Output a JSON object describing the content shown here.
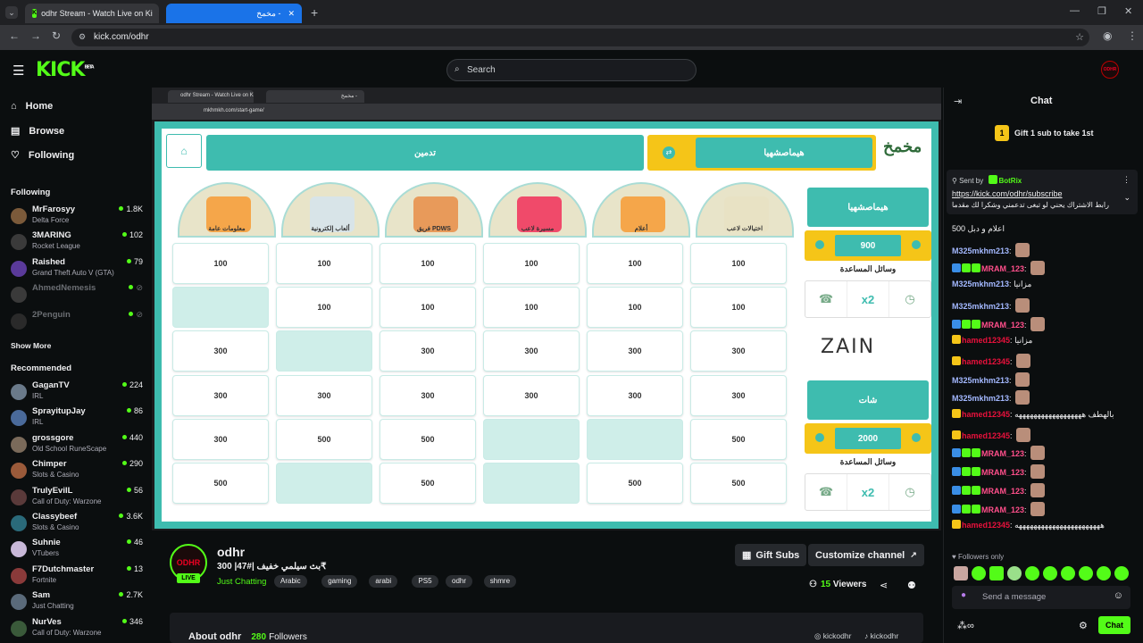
{
  "browser": {
    "tabs": [
      {
        "label": "odhr Stream - Watch Live on Ki"
      },
      {
        "label": "مخمخ -"
      }
    ],
    "url": "kick.com/odhr"
  },
  "header": {
    "logo": "KICK",
    "beta": "BETA",
    "search_placeholder": "Search",
    "avatar_text": "ODHR"
  },
  "sidebar": {
    "nav": [
      {
        "label": "Home"
      },
      {
        "label": "Browse"
      },
      {
        "label": "Following"
      }
    ],
    "following_title": "Following",
    "following": [
      {
        "name": "MrFarosyy",
        "game": "Delta Force",
        "viewers": "1.8K",
        "color": "#7b5a3a"
      },
      {
        "name": "3MARING",
        "game": "Rocket League",
        "viewers": "102",
        "color": "#3a3a3a"
      },
      {
        "name": "Raished",
        "game": "Grand Theft Auto V (GTA)",
        "viewers": "79",
        "color": "#5a3a9a"
      },
      {
        "name": "AhmedNemesis",
        "game": "",
        "viewers": "",
        "color": "#3a3a3a"
      },
      {
        "name": "2Penguin",
        "game": "",
        "viewers": "",
        "color": "#2a2a2a"
      }
    ],
    "show_more": "Show More",
    "recommended_title": "Recommended",
    "recommended": [
      {
        "name": "GaganTV",
        "game": "IRL",
        "viewers": "224",
        "color": "#6a7a8a"
      },
      {
        "name": "SprayitupJay",
        "game": "IRL",
        "viewers": "86",
        "color": "#4a6a9a"
      },
      {
        "name": "grossgore",
        "game": "Old School RuneScape",
        "viewers": "440",
        "color": "#7a6a5a"
      },
      {
        "name": "Chimper",
        "game": "Slots & Casino",
        "viewers": "290",
        "color": "#9a5a3a"
      },
      {
        "name": "TrulyEvilL",
        "game": "Call of Duty: Warzone",
        "viewers": "56",
        "color": "#5a3a3a"
      },
      {
        "name": "Classybeef",
        "game": "Slots & Casino",
        "viewers": "3.6K",
        "color": "#2a6a7a"
      },
      {
        "name": "Suhnie",
        "game": "VTubers",
        "viewers": "46",
        "color": "#c8b8d8"
      },
      {
        "name": "F7Dutchmaster",
        "game": "Fortnite",
        "viewers": "13",
        "color": "#8a3a3a"
      },
      {
        "name": "Sam",
        "game": "Just Chatting",
        "viewers": "2.7K",
        "color": "#5a6a7a"
      },
      {
        "name": "NurVes",
        "game": "Call of Duty: Warzone",
        "viewers": "346",
        "color": "#3a5a3a"
      }
    ]
  },
  "player": {
    "inner_tabs": [
      "odhr Stream - Watch Live on Ki",
      "مخمخ -"
    ],
    "inner_url": "mkhmkh.com/start-game/",
    "game": {
      "team1_button": "تدمين",
      "team2_button": "هيماصشهيا",
      "logo_text": "مخمخ",
      "categories": [
        "اختيالات لاعب",
        "أعلام",
        "مسيرة لاعب",
        "فريق PDWS",
        "ألعاب إلكترونية",
        "معلومات عامة"
      ],
      "grid": [
        [
          "100",
          "100",
          "100",
          "100",
          "100",
          "100"
        ],
        [
          "",
          "100",
          "100",
          "100",
          "100",
          "100"
        ],
        [
          "300",
          "",
          "300",
          "300",
          "300",
          "300"
        ],
        [
          "300",
          "300",
          "300",
          "300",
          "300",
          "300"
        ],
        [
          "300",
          "500",
          "500",
          "",
          "",
          "500"
        ],
        [
          "500",
          "",
          "500",
          "",
          "500",
          "500"
        ]
      ],
      "team_a": {
        "name": "هيماصشهيا",
        "score": "900",
        "aids_label": "وسائل المساعدة"
      },
      "sponsor": "ZAIN",
      "team_b": {
        "name": "شات",
        "score": "2000",
        "aids_label": "وسائل المساعدة"
      }
    }
  },
  "channel": {
    "name": "odhr",
    "title": "بث سيلمي خفيف |#47| 300₹",
    "category": "Just Chatting",
    "tags": [
      "Arabic",
      "gaming",
      "arabi",
      "PS5",
      "odhr",
      "shmre"
    ],
    "live": "LIVE",
    "gift_subs": "Gift Subs",
    "customize": "Customize channel",
    "viewers_count": "15",
    "viewers_label": "Viewers",
    "about": "About odhr",
    "followers_count": "280",
    "followers_label": "Followers",
    "social_1": "kickodhr",
    "social_2": "kickodhr"
  },
  "chat": {
    "title": "Chat",
    "gift_banner": "Gift 1 sub to take 1st",
    "gift_number": "1",
    "pinned_sent_by": "Sent by",
    "pinned_bot": "BotRix",
    "pinned_link": "https://kick.com/odhr/subscribe",
    "pinned_text": "رابط الاشتراك يحني لو تبغى تدعمني وشكرا لك مقدما 🤍 ...",
    "messages": [
      {
        "user": "",
        "text": "اعلام و دبل 500",
        "color": "#a3b8ff"
      },
      {
        "user": "M325mkhm213",
        "text": "",
        "color": "#a3b8ff"
      },
      {
        "user": "MRAM_123",
        "text": "",
        "color": "#ff4f8b"
      },
      {
        "user": "M325mkhm213",
        "text": "مزانيا",
        "color": "#a3b8ff"
      },
      {
        "user": "M325mkhm213",
        "text": "",
        "color": "#a3b8ff"
      },
      {
        "user": "MRAM_123",
        "text": "",
        "color": "#ff4f8b"
      },
      {
        "user": "hamed12345",
        "text": "مزانيا",
        "color": "#e9113c"
      },
      {
        "user": "hamed12345",
        "text": "",
        "color": "#e9113c"
      },
      {
        "user": "M325mkhm213",
        "text": "",
        "color": "#a3b8ff"
      },
      {
        "user": "M325mkhm213",
        "text": "",
        "color": "#a3b8ff"
      },
      {
        "user": "hamed12345",
        "text": "بالهطف ههههههههههههههههههه",
        "color": "#e9113c"
      },
      {
        "user": "hamed12345",
        "text": "",
        "color": "#e9113c"
      },
      {
        "user": "MRAM_123",
        "text": "",
        "color": "#ff4f8b"
      },
      {
        "user": "MRAM_123",
        "text": "",
        "color": "#ff4f8b"
      },
      {
        "user": "MRAM_123",
        "text": "",
        "color": "#ff4f8b"
      },
      {
        "user": "MRAM_123",
        "text": "",
        "color": "#ff4f8b"
      },
      {
        "user": "hamed12345",
        "text": "هههههههههههههههههههههههه",
        "color": "#e9113c"
      }
    ],
    "followers_only": "Followers only",
    "send_placeholder": "Send a message",
    "chat_button": "Chat"
  },
  "colors": {
    "kick_green": "#53fc18",
    "game_teal": "#3ebcaf",
    "game_yellow": "#f5c518"
  }
}
